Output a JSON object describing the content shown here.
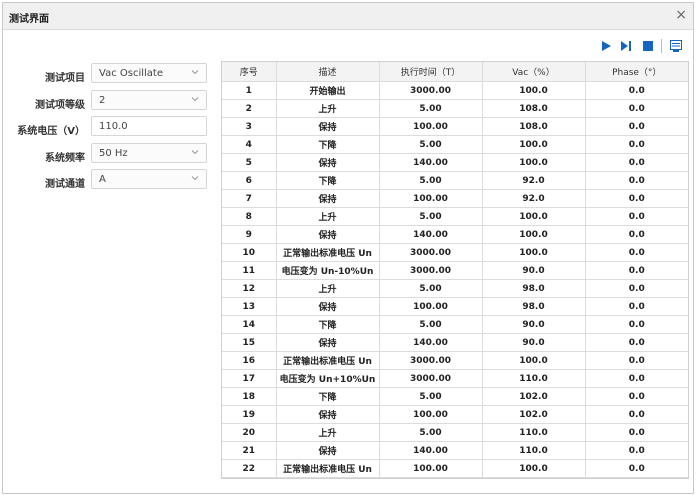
{
  "window": {
    "title": "测试界面",
    "close_glyph": "×"
  },
  "toolbar": {
    "buttons": [
      {
        "icon": "play-icon",
        "color": "#1565c0"
      },
      {
        "icon": "step-forward-icon",
        "color": "#1565c0"
      },
      {
        "icon": "stop-icon",
        "color": "#1565c0"
      },
      {
        "icon": "export-icon",
        "color": "#1565c0"
      }
    ]
  },
  "form": {
    "test_item": {
      "label": "测试项目",
      "value": "Vac Oscillate"
    },
    "test_level": {
      "label": "测试项等级",
      "value": "2"
    },
    "system_voltage": {
      "label": "系统电压（V）",
      "value": "110.0"
    },
    "system_frequency": {
      "label": "系统频率",
      "value": "50 Hz"
    },
    "test_channel": {
      "label": "测试通道",
      "value": "A"
    }
  },
  "table": {
    "headers": [
      "序号",
      "描述",
      "执行时间（T）",
      "Vac（%）",
      "Phase（°）"
    ],
    "rows": [
      [
        "1",
        "开始输出",
        "3000.00",
        "100.0",
        "0.0"
      ],
      [
        "2",
        "上升",
        "5.00",
        "108.0",
        "0.0"
      ],
      [
        "3",
        "保持",
        "100.00",
        "108.0",
        "0.0"
      ],
      [
        "4",
        "下降",
        "5.00",
        "100.0",
        "0.0"
      ],
      [
        "5",
        "保持",
        "140.00",
        "100.0",
        "0.0"
      ],
      [
        "6",
        "下降",
        "5.00",
        "92.0",
        "0.0"
      ],
      [
        "7",
        "保持",
        "100.00",
        "92.0",
        "0.0"
      ],
      [
        "8",
        "上升",
        "5.00",
        "100.0",
        "0.0"
      ],
      [
        "9",
        "保持",
        "140.00",
        "100.0",
        "0.0"
      ],
      [
        "10",
        "正常输出标准电压 Un",
        "3000.00",
        "100.0",
        "0.0"
      ],
      [
        "11",
        "电压变为 Un-10%Un",
        "3000.00",
        "90.0",
        "0.0"
      ],
      [
        "12",
        "上升",
        "5.00",
        "98.0",
        "0.0"
      ],
      [
        "13",
        "保持",
        "100.00",
        "98.0",
        "0.0"
      ],
      [
        "14",
        "下降",
        "5.00",
        "90.0",
        "0.0"
      ],
      [
        "15",
        "保持",
        "140.00",
        "90.0",
        "0.0"
      ],
      [
        "16",
        "正常输出标准电压 Un",
        "3000.00",
        "100.0",
        "0.0"
      ],
      [
        "17",
        "电压变为 Un+10%Un",
        "3000.00",
        "110.0",
        "0.0"
      ],
      [
        "18",
        "下降",
        "5.00",
        "102.0",
        "0.0"
      ],
      [
        "19",
        "保持",
        "100.00",
        "102.0",
        "0.0"
      ],
      [
        "20",
        "上升",
        "5.00",
        "110.0",
        "0.0"
      ],
      [
        "21",
        "保持",
        "140.00",
        "110.0",
        "0.0"
      ],
      [
        "22",
        "正常输出标准电压 Un",
        "100.00",
        "100.0",
        "0.0"
      ]
    ]
  }
}
